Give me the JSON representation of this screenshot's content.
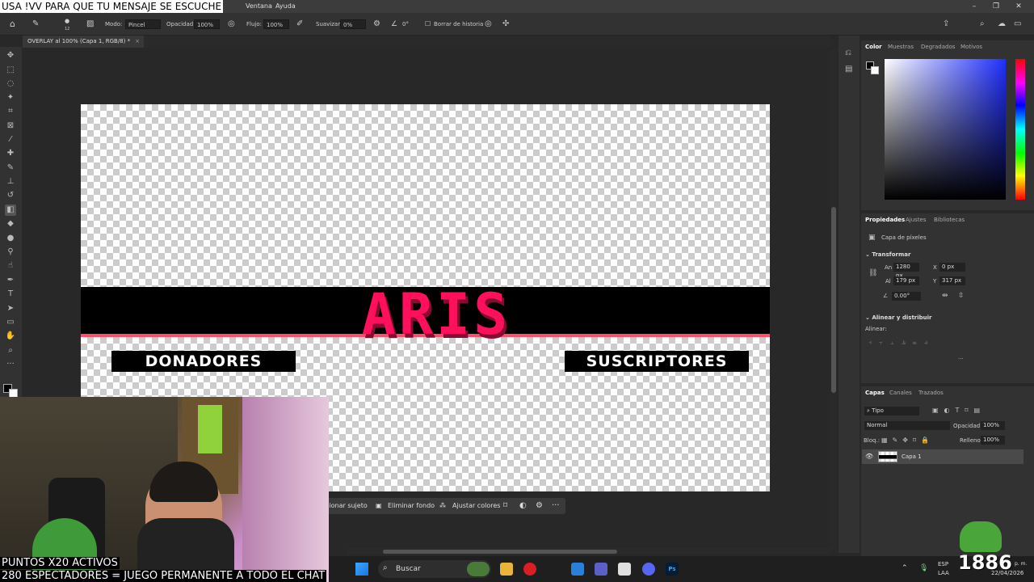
{
  "stream": {
    "ticker": "USA !VV PARA QUE TU MENSAJE SE ESCUCHE",
    "overlay_line1": "PUNTOS X20 ACTIVOS",
    "overlay_line2": "280 ESPECTADORES = JUEGO PERMANENTE A TODO EL CHAT",
    "badge": "1886"
  },
  "menu": {
    "items": [
      "Ventana",
      "Ayuda"
    ]
  },
  "options": {
    "mode_label": "Modo:",
    "mode_value": "Pincel",
    "opacity_label": "Opacidad:",
    "opacity_value": "100%",
    "flow_label": "Flujo:",
    "flow_value": "100%",
    "smooth_label": "Suavizar:",
    "smooth_value": "0%",
    "angle_value": "0°",
    "brush_size": "12",
    "history_label": "Borrar de historia"
  },
  "document": {
    "tab_title": "OVERLAY al 100% (Capa 1, RGB/8) *"
  },
  "canvas": {
    "title": "ARIS",
    "left_label": "DONADORES",
    "right_label": "SUSCRIPTORES"
  },
  "context_bar": {
    "select_subject": "cionar sujeto",
    "remove_bg": "Eliminar fondo",
    "adjust_colors": "Ajustar colores"
  },
  "color_panel": {
    "tabs": [
      "Color",
      "Muestras",
      "Degradados",
      "Motivos"
    ]
  },
  "properties_panel": {
    "tabs": [
      "Propiedades",
      "Ajustes",
      "Bibliotecas"
    ],
    "layer_type": "Capa de píxeles",
    "transform_label": "Transformar",
    "w_label": "An",
    "w_value": "1280 px",
    "x_label": "X",
    "x_value": "0 px",
    "h_label": "Al",
    "h_value": "179 px",
    "y_label": "Y",
    "y_value": "317 px",
    "angle_value": "0.00°",
    "align_section": "Alinear y distribuir",
    "align_label": "Alinear:"
  },
  "layers_panel": {
    "tabs": [
      "Capas",
      "Canales",
      "Trazados"
    ],
    "filter": "Tipo",
    "blend_mode": "Normal",
    "opacity_label": "Opacidad:",
    "opacity_value": "100%",
    "lock_label": "Bloq.:",
    "fill_label": "Relleno:",
    "fill_value": "100%",
    "layer_name": "Capa 1"
  },
  "taskbar": {
    "search_placeholder": "Buscar",
    "lang": "ESP",
    "lang2": "LAA",
    "date": "22/04/2026",
    "time_suffix": "p. m."
  },
  "colors": {
    "accent_pink": "#ff0f5c",
    "ps_bg": "#282828"
  }
}
